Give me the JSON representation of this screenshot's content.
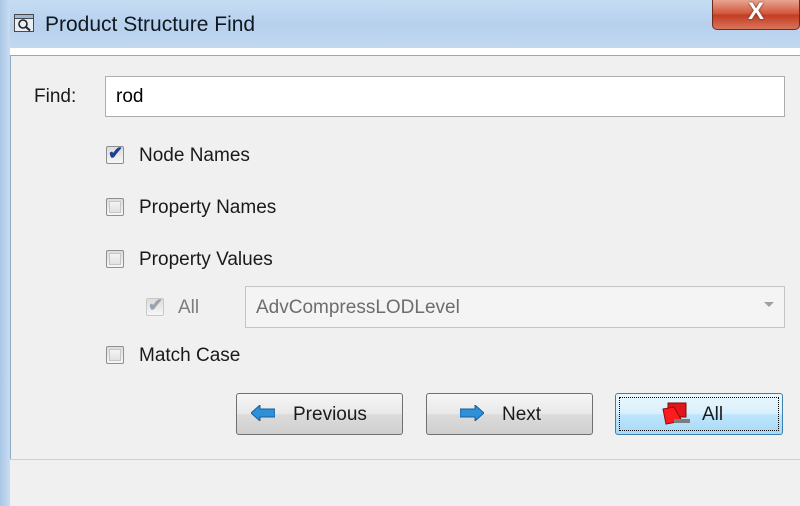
{
  "window": {
    "title": "Product Structure Find",
    "close_glyph": "X",
    "icon": "search-window-icon"
  },
  "find": {
    "label": "Find:",
    "value": "rod"
  },
  "options": {
    "node_names": {
      "label": "Node Names",
      "checked": true
    },
    "property_names": {
      "label": "Property Names",
      "checked": false
    },
    "property_values": {
      "label": "Property Values",
      "checked": false
    },
    "all": {
      "label": "All",
      "checked": true,
      "enabled": false
    },
    "match_case": {
      "label": "Match Case",
      "checked": false
    }
  },
  "property_combo": {
    "selected": "AdvCompressLODLevel",
    "enabled": false
  },
  "buttons": {
    "previous": "Previous",
    "next": "Next",
    "all": "All"
  },
  "colors": {
    "arrow_blue": "#2f8fd8",
    "all_icon_red": "#e0161b"
  }
}
